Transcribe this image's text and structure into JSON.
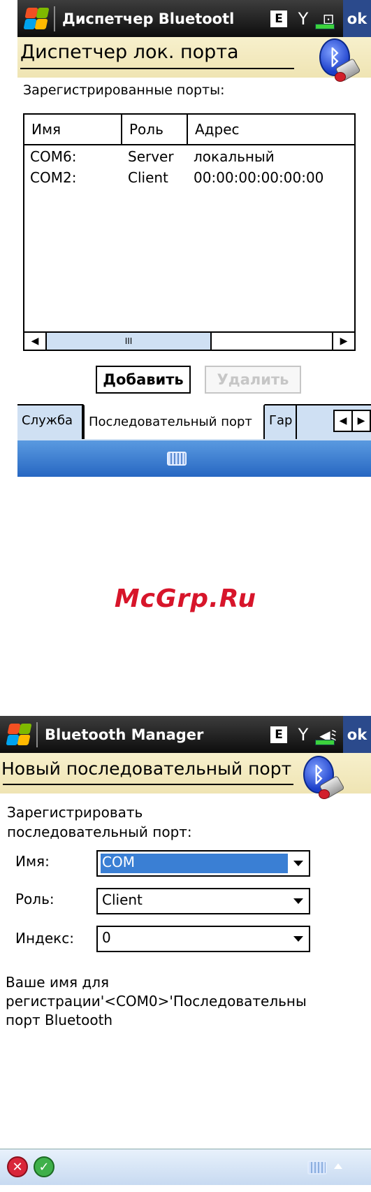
{
  "screen1": {
    "app_title": "Диспетчер Bluetootl",
    "status": {
      "e_label": "E",
      "ok_label": "ok"
    },
    "header_title": "Диспетчер лок. порта",
    "list_label": "Зарегистрированные порты:",
    "columns": [
      "Имя",
      "Роль",
      "Адрес"
    ],
    "rows": [
      {
        "name": "COM6:",
        "role": "Server",
        "address": "локальный"
      },
      {
        "name": "COM2:",
        "role": "Client",
        "address": "00:00:00:00:00:00"
      }
    ],
    "scroll_grip": "III",
    "buttons": {
      "add": "Добавить",
      "delete": "Удалить"
    },
    "tabs": [
      "Служба",
      "Последовательный порт",
      "Гар"
    ]
  },
  "watermark": "McGrp.Ru",
  "screen2": {
    "app_title": "Bluetooth Manager",
    "status": {
      "e_label": "E",
      "ok_label": "ok"
    },
    "header_title": "Новый последовательный порт",
    "intro_line1": "Зарегистрировать",
    "intro_line2": "последовательный порт:",
    "fields": {
      "name_label": "Имя:",
      "name_value": "COM",
      "role_label": "Роль:",
      "role_value": "Client",
      "index_label": "Индекс:",
      "index_value": "0"
    },
    "info_line1": "Ваше имя для",
    "info_line2": "регистрации'<COM0>'Последовательны",
    "info_line3": "порт Bluetooth"
  },
  "colors": {
    "accent_blue": "#2767c2",
    "header_band": "#f7f0cc",
    "selection": "#3a7fd4",
    "watermark": "#d7152a"
  },
  "icons": [
    "windows-start-icon",
    "signal-icon",
    "battery-icon",
    "keyboard-icon",
    "bluetooth-icon",
    "cancel-icon",
    "confirm-icon",
    "volume-icon"
  ]
}
